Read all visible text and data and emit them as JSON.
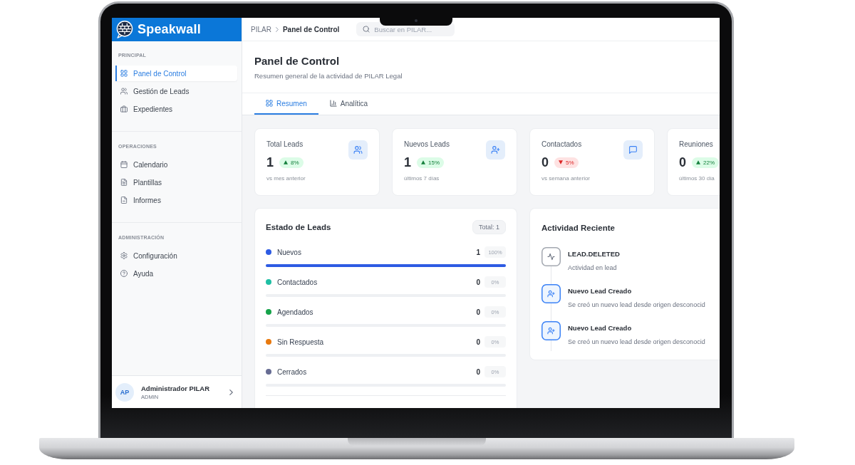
{
  "app": {
    "name": "Speakwall"
  },
  "sidebar": {
    "sections": [
      {
        "title": "PRINCIPAL",
        "items": [
          {
            "label": "Panel de Control",
            "selected": true
          },
          {
            "label": "Gestión de Leads",
            "selected": false
          },
          {
            "label": "Expedientes",
            "selected": false
          }
        ]
      },
      {
        "title": "OPERACIONES",
        "items": [
          {
            "label": "Calendario",
            "selected": false
          },
          {
            "label": "Plantillas",
            "selected": false
          },
          {
            "label": "Informes",
            "selected": false
          }
        ]
      },
      {
        "title": "ADMINISTRACIÓN",
        "items": [
          {
            "label": "Configuración",
            "selected": false
          },
          {
            "label": "Ayuda",
            "selected": false
          }
        ]
      }
    ],
    "user": {
      "initials": "AP",
      "name": "Administrador PILAR",
      "role": "ADMIN"
    }
  },
  "header": {
    "breadcrumb": [
      "PILAR",
      "Panel de Control"
    ],
    "search": {
      "placeholder": "Buscar en PILAR..."
    }
  },
  "page": {
    "title": "Panel de Control",
    "subtitle": "Resumen general de la actividad de PILAR Legal"
  },
  "tabs": [
    {
      "label": "Resumen",
      "selected": true
    },
    {
      "label": "Analítica",
      "selected": false
    }
  ],
  "stats": [
    {
      "label": "Total Leads",
      "value": "1",
      "change": "8%",
      "rising": true,
      "note": "vs mes anterior"
    },
    {
      "label": "Nuevos Leads",
      "value": "1",
      "change": "15%",
      "rising": true,
      "note": "últimos 7 días"
    },
    {
      "label": "Contactados",
      "value": "0",
      "change": "5%",
      "rising": false,
      "note": "vs semana anterior"
    },
    {
      "label": "Reuniones",
      "value": "0",
      "change": "22%",
      "rising": true,
      "note": "últimos 30 día"
    }
  ],
  "lead_status": {
    "title": "Estado de Leads",
    "total": "Total: 1",
    "rows": [
      {
        "label": "Nuevos",
        "color": "#2d5be3",
        "count": "1",
        "percent": "100%",
        "level": 1
      },
      {
        "label": "Contactados",
        "color": "#1fbfa4",
        "count": "0",
        "percent": "0%",
        "level": 0
      },
      {
        "label": "Agendados",
        "color": "#16a34a",
        "count": "0",
        "percent": "0%",
        "level": 0
      },
      {
        "label": "Sin Respuesta",
        "color": "#e8790e",
        "count": "0",
        "percent": "0%",
        "level": 0
      },
      {
        "label": "Cerrados",
        "color": "#676c93",
        "count": "0",
        "percent": "0%",
        "level": 0
      }
    ]
  },
  "activity": {
    "title": "Actividad Reciente",
    "items": [
      {
        "kind": "event",
        "title": "LEAD.DELETED",
        "description": "Actividad en lead"
      },
      {
        "kind": "new_lead",
        "title": "Nuevo Lead Creado",
        "description": "Se creó un nuevo lead desde origen desconocid"
      },
      {
        "kind": "new_lead",
        "title": "Nuevo Lead Creado",
        "description": "Se creó un nuevo lead desde origen desconocid"
      }
    ]
  }
}
